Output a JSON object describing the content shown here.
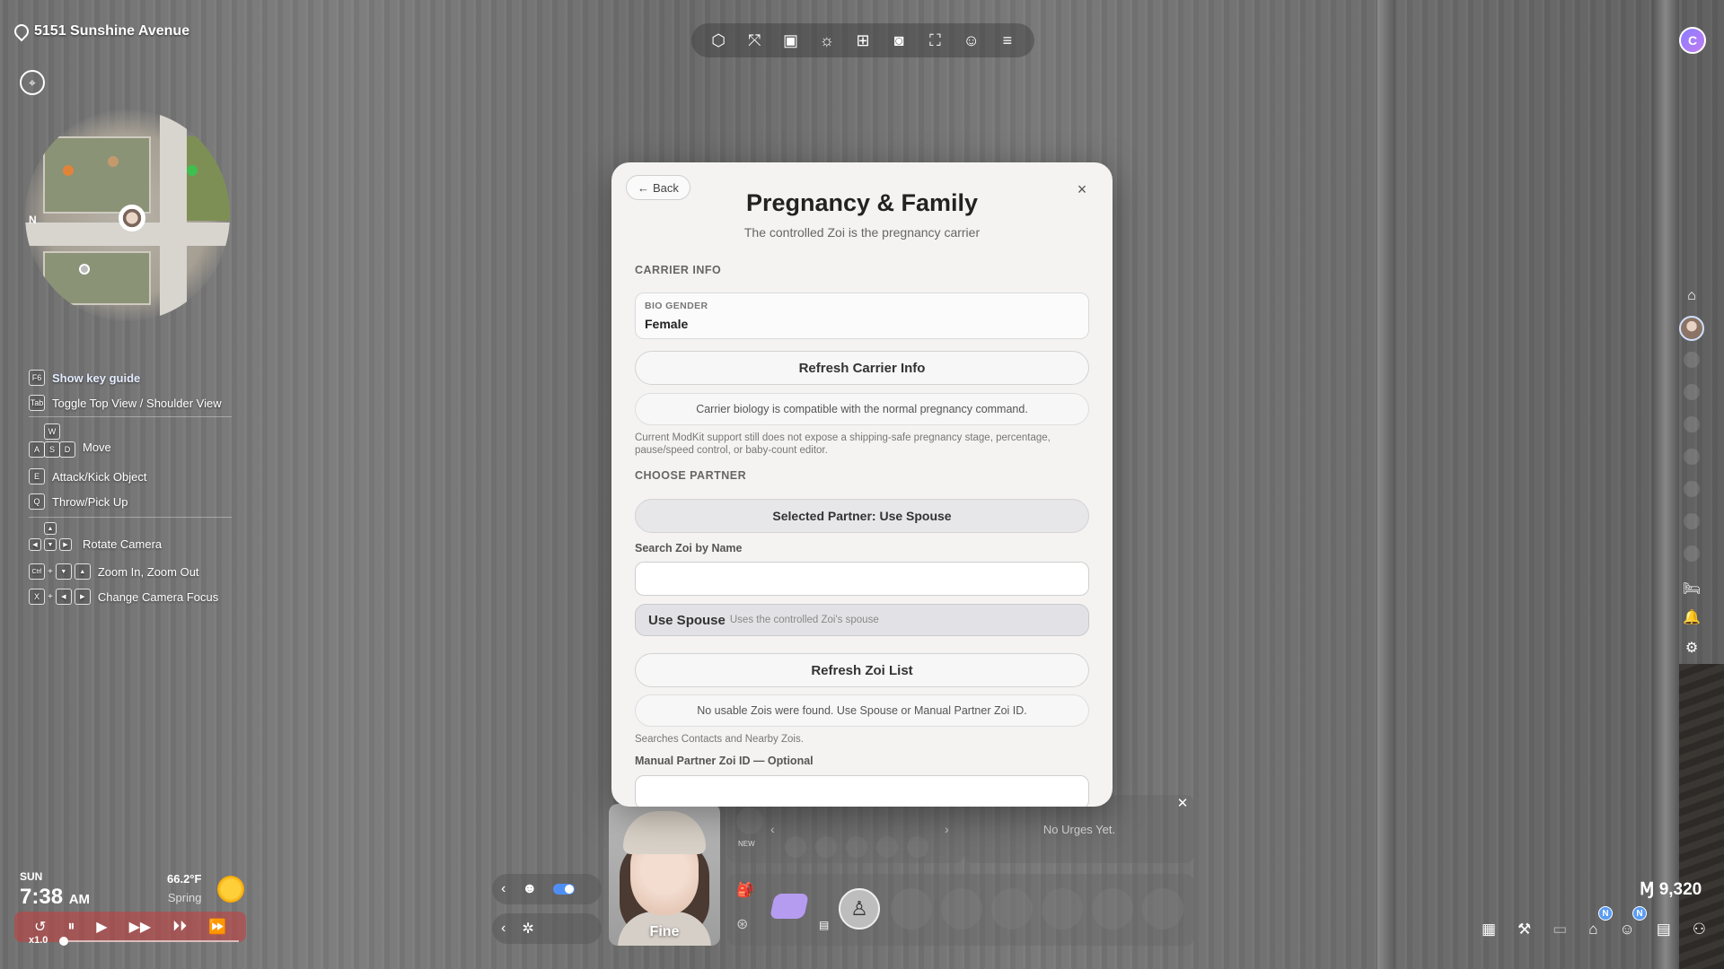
{
  "location": {
    "address": "5151 Sunshine Avenue"
  },
  "minimap": {
    "north_label": "N"
  },
  "key_guide": {
    "items": [
      {
        "keys": [
          "F6"
        ],
        "label": "Show key guide"
      },
      {
        "keys": [
          "Tab"
        ],
        "label": "Toggle Top View / Shoulder View"
      },
      {
        "keys": [
          "W",
          "A",
          "S",
          "D"
        ],
        "label": "Move"
      },
      {
        "keys": [
          "E"
        ],
        "label": "Attack/Kick Object"
      },
      {
        "keys": [
          "Q"
        ],
        "label": "Throw/Pick Up"
      },
      {
        "keys": [
          "▲",
          "◀",
          "▼",
          "▶"
        ],
        "label": "Rotate Camera"
      },
      {
        "keys": [
          "Ctrl",
          "+",
          "▼",
          "▲"
        ],
        "label": "Zoom In, Zoom Out"
      },
      {
        "keys": [
          "X",
          "+",
          "◀",
          "▶"
        ],
        "label": "Change Camera Focus"
      }
    ]
  },
  "toolbar": {
    "icons": [
      "build-mode-icon",
      "measure-icon",
      "camera-video-icon",
      "light-icon",
      "add-photo-icon",
      "photo-camera-icon",
      "focus-frame-icon",
      "face-capture-icon",
      "menu-icon"
    ]
  },
  "profile": {
    "initial": "C"
  },
  "time": {
    "day": "SUN",
    "clock": "7:38",
    "ampm": "AM",
    "temperature": "66.2°F",
    "season": "Spring",
    "speed": "x1.0"
  },
  "zoi": {
    "mood": "Fine"
  },
  "urges": {
    "empty_text": "No Urges Yet."
  },
  "panel": {
    "new_label": "NEW"
  },
  "currency": {
    "symbol": "Ɱ",
    "amount": "9,320"
  },
  "notifications": {
    "badge_1": "N",
    "badge_2": "N"
  },
  "modal": {
    "back_label": "Back",
    "close_label": "×",
    "title": "Pregnancy & Family",
    "subtitle": "The controlled Zoi is the pregnancy carrier",
    "carrier_section": "CARRIER INFO",
    "bio_gender_label": "BIO GENDER",
    "bio_gender_value": "Female",
    "refresh_carrier_label": "Refresh Carrier Info",
    "carrier_notice": "Carrier biology is compatible with the normal pregnancy command.",
    "modkit_note": "Current ModKit support still does not expose a shipping-safe pregnancy stage, percentage, pause/speed control, or baby-count editor.",
    "partner_section": "CHOOSE PARTNER",
    "selected_partner_label": "Selected Partner: Use Spouse",
    "search_label": "Search Zoi by Name",
    "search_value": "",
    "option_name": "Use Spouse",
    "option_desc": "Uses the controlled Zoi's spouse",
    "refresh_list_label": "Refresh Zoi List",
    "no_zois_notice": "No usable Zois were found. Use Spouse or Manual Partner Zoi ID.",
    "search_hint": "Searches Contacts and Nearby Zois.",
    "manual_label": "Manual Partner Zoi ID — Optional",
    "manual_value": ""
  }
}
